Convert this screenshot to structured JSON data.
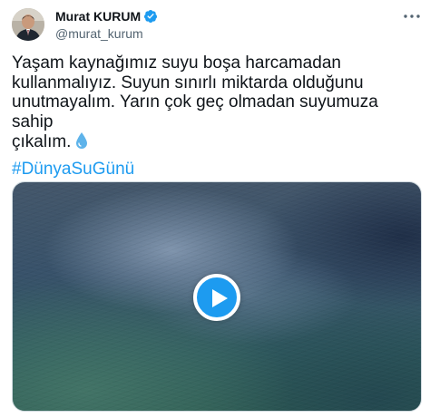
{
  "author": {
    "display_name": "Murat KURUM",
    "handle": "@murat_kurum",
    "verified_icon": "verified-badge-icon"
  },
  "tweet": {
    "text": "Yaşam kaynağımız suyu boşa harcamadan\nkullanmalıyız. Suyun sınırlı miktarda olduğunu\nunutmayalım. Yarın çok geç olmadan suyumuza sahip\nçıkalım.",
    "emoji": "water-drop-icon",
    "hashtag": "#DünyaSuGünü"
  },
  "media": {
    "type": "video",
    "play_icon": "play-icon"
  },
  "colors": {
    "accent": "#1d9bf0",
    "text_primary": "#0f1419",
    "text_secondary": "#536471"
  }
}
